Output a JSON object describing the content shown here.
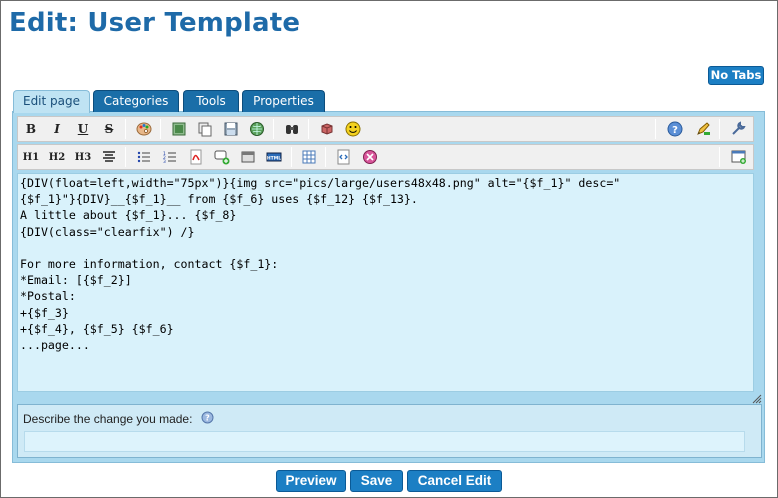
{
  "page": {
    "title": "Edit: User Template"
  },
  "controls": {
    "no_tabs": "No Tabs"
  },
  "tabs": [
    {
      "label": "Edit page",
      "active": true
    },
    {
      "label": "Categories",
      "active": false
    },
    {
      "label": "Tools",
      "active": false
    },
    {
      "label": "Properties",
      "active": false
    }
  ],
  "toolbar": {
    "row1": [
      "bold",
      "italic",
      "underline",
      "strikethrough",
      "color-palette",
      "image",
      "copy",
      "floppy-disk",
      "globe",
      "binoculars",
      "box",
      "smiley",
      "help",
      "pencil-edit",
      "wrench"
    ],
    "row1_labels": {
      "bold": "B",
      "italic": "I",
      "underline": "U",
      "strike": "S"
    },
    "row2": [
      "h1",
      "h2",
      "h3",
      "align-center",
      "bullet-list",
      "numbered-list",
      "pdf",
      "add-comment",
      "box-frame",
      "html",
      "table",
      "source",
      "remove",
      "new-window"
    ],
    "row2_labels": {
      "h1": "H1",
      "h2": "H2",
      "h3": "H3"
    }
  },
  "editor": {
    "content": "{DIV(float=left,width=\"75px\")}{img src=\"pics/large/users48x48.png\" alt=\"{$f_1}\" desc=\"\n{$f_1}\"}{DIV}__{$f_1}__ from {$f_6} uses {$f_12} {$f_13}.\nA little about {$f_1}... {$f_8}\n{DIV(class=\"clearfix\") /}\n\nFor more information, contact {$f_1}:\n*Email: [{$f_2}]\n*Postal:\n+{$f_3}\n+{$f_4}, {$f_5} {$f_6}\n...page..."
  },
  "change": {
    "label": "Describe the change you made:",
    "value": "",
    "placeholder": ""
  },
  "actions": {
    "preview": "Preview",
    "save": "Save",
    "cancel": "Cancel Edit"
  },
  "colors": {
    "accent": "#1c7fc4",
    "title": "#1e6aa8",
    "panel": "#a9d8ee",
    "editor_bg": "#d9f2fb"
  }
}
